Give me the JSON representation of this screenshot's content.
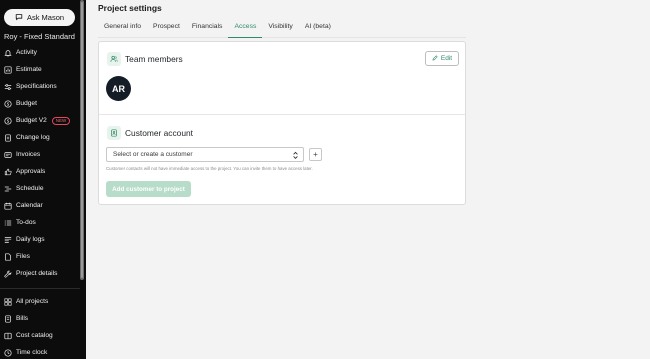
{
  "sidebar": {
    "ask_label": "Ask Mason",
    "project_name": "Roy - Fixed Standard",
    "items": [
      {
        "label": "Activity",
        "icon": "bell-icon"
      },
      {
        "label": "Estimate",
        "icon": "chart-icon"
      },
      {
        "label": "Specifications",
        "icon": "sliders-icon"
      },
      {
        "label": "Budget",
        "icon": "dollar-icon"
      },
      {
        "label": "Budget V2",
        "icon": "dollar-icon",
        "badge": "NEW"
      },
      {
        "label": "Change log",
        "icon": "document-icon"
      },
      {
        "label": "Invoices",
        "icon": "invoice-icon"
      },
      {
        "label": "Approvals",
        "icon": "thumbs-up-icon"
      },
      {
        "label": "Schedule",
        "icon": "schedule-icon"
      },
      {
        "label": "Calendar",
        "icon": "calendar-icon"
      },
      {
        "label": "To-dos",
        "icon": "list-icon"
      },
      {
        "label": "Daily logs",
        "icon": "log-icon"
      },
      {
        "label": "Files",
        "icon": "files-icon"
      },
      {
        "label": "Project details",
        "icon": "wrench-icon"
      }
    ],
    "footer_items": [
      {
        "label": "All projects",
        "icon": "grid-icon"
      },
      {
        "label": "Bills",
        "icon": "bill-icon"
      },
      {
        "label": "Cost catalog",
        "icon": "catalog-icon"
      },
      {
        "label": "Time clock",
        "icon": "clock-icon"
      }
    ]
  },
  "page": {
    "title": "Project settings",
    "tabs": [
      {
        "label": "General info",
        "active": false
      },
      {
        "label": "Prospect",
        "active": false
      },
      {
        "label": "Financials",
        "active": false
      },
      {
        "label": "Access",
        "active": true
      },
      {
        "label": "Visibility",
        "active": false
      },
      {
        "label": "AI (beta)",
        "active": false
      }
    ]
  },
  "team": {
    "title": "Team members",
    "edit_label": "Edit",
    "avatar_initials": "AR"
  },
  "customer": {
    "title": "Customer account",
    "select_placeholder": "Select or create a customer",
    "plus_label": "+",
    "helper_text": "Customer contacts will not have immediate access to the project. You can invite them to have access later.",
    "add_label": "Add customer to project"
  },
  "colors": {
    "accent": "#2f8a66",
    "sidebar_bg": "#0c0c0c",
    "badge": "#e0485b",
    "add_button_disabled": "#b7dcc9"
  }
}
